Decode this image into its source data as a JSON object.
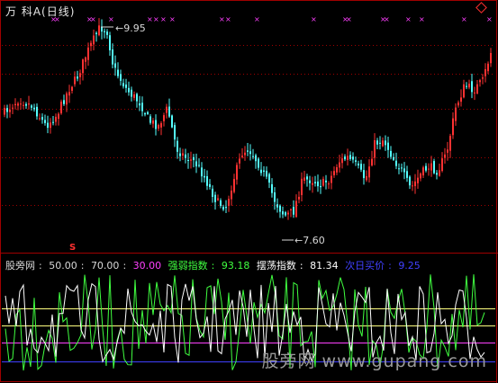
{
  "header": {
    "title": "万 科A(日线)"
  },
  "price_panel": {
    "high_label": "9.95",
    "low_label": "7.60",
    "s_marker": "S",
    "colors": {
      "up": "#ff3232",
      "down": "#54ffff",
      "marker": "#ff40ff",
      "grid": "#a00000"
    }
  },
  "indicator": {
    "name": "股旁网",
    "level1": "50.00",
    "level2": "70.00",
    "level3": "30.00",
    "strong_label": "强弱指数",
    "strong_value": "93.18",
    "swing_label": "摆荡指数",
    "swing_value": "81.34",
    "next_label": "次日买价",
    "next_value": "9.25",
    "colors": {
      "strong": "#40ff40",
      "swing": "#ffffff",
      "next": "#4040ff",
      "level3": "#ff40ff",
      "yellow": "#ffff80"
    }
  },
  "watermark": {
    "text": "股旁网 www.gupang.com"
  }
}
